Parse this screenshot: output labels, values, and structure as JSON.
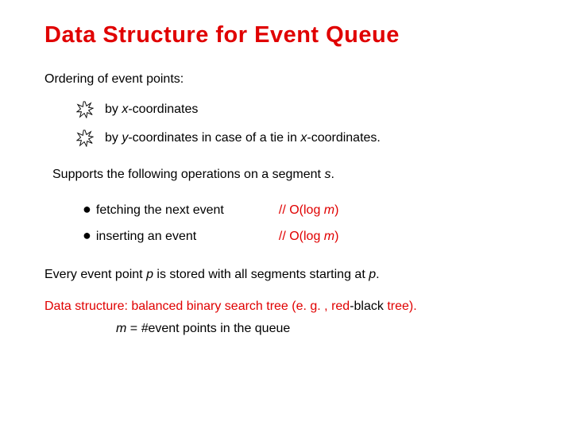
{
  "title": "Data Structure for Event Queue",
  "ordering_label": "Ordering of event points:",
  "bullet1_pre": "by ",
  "bullet1_x": "x",
  "bullet1_post": "-coordinates",
  "bullet2_pre": "by ",
  "bullet2_y": "y",
  "bullet2_mid": "-coordinates in case of a tie in ",
  "bullet2_x": "x",
  "bullet2_post": "-coordinates.",
  "supports_pre": "Supports the following operations on a segment ",
  "supports_s": "s",
  "supports_post": ".",
  "op1": "fetching the next event",
  "op2": "inserting an event",
  "cx_pre": "// O(log ",
  "cx_m": "m",
  "cx_post": ")",
  "every_pre": "Every event point ",
  "every_p1": "p",
  "every_mid": " is stored with all segments starting at ",
  "every_p2": "p",
  "every_post": ".",
  "ds_pre": "Data structure: balanced binary search tree (e. g. , ",
  "ds_red": "red",
  "ds_dash": "-black ",
  "ds_tree": "tree",
  "ds_post": ").",
  "mline_m": "m",
  "mline_eq": " = ",
  "mline_hash": "#",
  "mline_rest": "event points in the queue"
}
